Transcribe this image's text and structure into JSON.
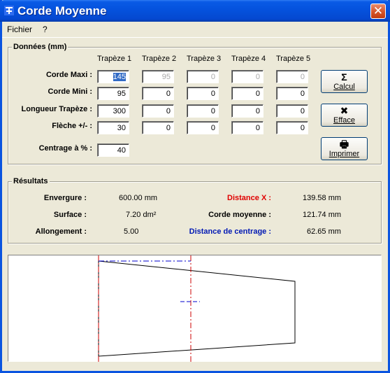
{
  "window": {
    "title": "Corde Moyenne",
    "close_glyph": "✕"
  },
  "menu": {
    "items": [
      "Fichier",
      "?"
    ]
  },
  "donnees": {
    "title": "Données (mm)",
    "columns": [
      "Trapèze 1",
      "Trapèze 2",
      "Trapèze 3",
      "Trapèze 4",
      "Trapèze 5"
    ],
    "rows": [
      {
        "label": "Corde Maxi :",
        "values": [
          "145",
          "95",
          "0",
          "0",
          "0"
        ]
      },
      {
        "label": "Corde Mini :",
        "values": [
          "95",
          "0",
          "0",
          "0",
          "0"
        ]
      },
      {
        "label": "Longueur Trapèze :",
        "values": [
          "300",
          "0",
          "0",
          "0",
          "0"
        ]
      },
      {
        "label": "Flèche  +/- :",
        "values": [
          "30",
          "0",
          "0",
          "0",
          "0"
        ]
      }
    ],
    "centrage_label": "Centrage à  % :",
    "centrage_value": "40"
  },
  "buttons": {
    "calcul": {
      "glyph": "Σ",
      "label": "Calcul",
      "icon": "sigma-icon"
    },
    "efface": {
      "glyph": "✖",
      "label": "Efface",
      "icon": "x-icon"
    },
    "imprimer": {
      "glyph": "🖶",
      "label": "Imprimer",
      "icon": "printer-icon"
    }
  },
  "resultats": {
    "title": "Résultats",
    "left": [
      {
        "label": "Envergure :",
        "value": "600.00 mm"
      },
      {
        "label": "Surface :",
        "value": "7.20 dm²"
      },
      {
        "label": "Allongement :",
        "value": "5.00"
      }
    ],
    "right": [
      {
        "label": "Distance X :",
        "value": "139.58 mm",
        "color": "#e00000"
      },
      {
        "label": "Corde moyenne :",
        "value": "121.74 mm",
        "color": "#000000"
      },
      {
        "label": "Distance de centrage :",
        "value": "62.65 mm",
        "color": "#0018b4"
      }
    ]
  },
  "colors": {
    "titlebar": "#0553de",
    "window_bg": "#ece9d8",
    "guide_line": "#cc0000",
    "center_mark": "#0000cc"
  }
}
